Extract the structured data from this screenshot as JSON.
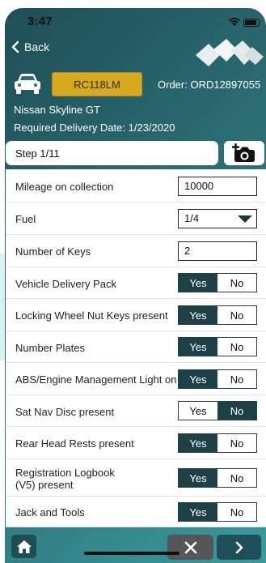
{
  "status_bar": {
    "time": "3:47",
    "signal": "...."
  },
  "nav": {
    "back_label": "Back"
  },
  "vehicle": {
    "registration": "RC118LM",
    "order": "Order: ORD12897055",
    "model": "Nissan Skyline GT",
    "delivery_date": "Required Delivery Date: 1/23/2020"
  },
  "step": {
    "label": "Step 1/11"
  },
  "form": {
    "mileage": {
      "label": "Mileage on collection",
      "value": "10000"
    },
    "fuel": {
      "label": "Fuel",
      "value": "1/4"
    },
    "keys": {
      "label": "Number of Keys",
      "value": "2"
    },
    "toggles": [
      {
        "label": "Vehicle Delivery Pack",
        "selected": "Yes"
      },
      {
        "label": "Locking Wheel Nut Keys present",
        "selected": "Yes"
      },
      {
        "label": "Number Plates",
        "selected": "Yes"
      },
      {
        "label": "ABS/Engine Management Light on",
        "selected": "Yes"
      },
      {
        "label": "Sat Nav Disc present",
        "selected": "No"
      },
      {
        "label": "Rear Head Rests present",
        "selected": "Yes"
      },
      {
        "label": "Registration Logbook",
        "label2": "(V5) present",
        "selected": "Yes"
      },
      {
        "label": "Jack and Tools",
        "selected": "Yes"
      }
    ],
    "yes_label": "Yes",
    "no_label": "No"
  },
  "colors": {
    "primary": "#1e4047",
    "plate": "#d7a91f",
    "cancel": "#565656"
  }
}
